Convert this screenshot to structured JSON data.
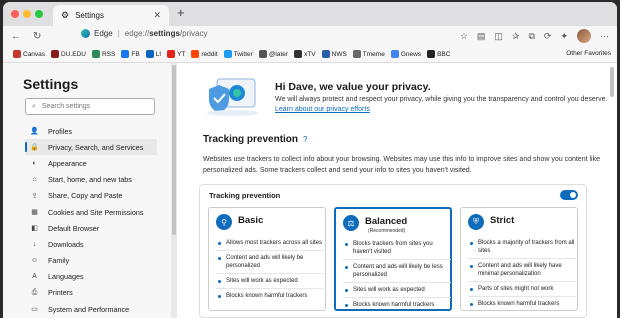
{
  "tab": {
    "title": "Settings",
    "close": "✕",
    "new": "+"
  },
  "address": {
    "site_label": "Edge",
    "url_prefix": "edge://",
    "url_path": "settings",
    "url_suffix": "/privacy"
  },
  "bookmarks": [
    {
      "label": "Canvas",
      "color": "#c0392b"
    },
    {
      "label": "DU.EDU",
      "color": "#8b1a1a"
    },
    {
      "label": "RSS",
      "color": "#2e8b57"
    },
    {
      "label": "FB",
      "color": "#1877f2"
    },
    {
      "label": "LI",
      "color": "#0a66c2"
    },
    {
      "label": "YT",
      "color": "#e62117"
    },
    {
      "label": "reddit",
      "color": "#ff4500"
    },
    {
      "label": "Twitter",
      "color": "#1d9bf0"
    },
    {
      "label": "@later",
      "color": "#555555"
    },
    {
      "label": "xTV",
      "color": "#333333"
    },
    {
      "label": "NWS",
      "color": "#2b5fa8"
    },
    {
      "label": "Tmeme",
      "color": "#666666"
    },
    {
      "label": "Gnews",
      "color": "#4285f4"
    },
    {
      "label": "BBC",
      "color": "#222222"
    }
  ],
  "other_favorites": "Other Favorites",
  "sidebar": {
    "title": "Settings",
    "search_placeholder": "Search settings",
    "items": [
      {
        "label": "Profiles",
        "icon": "👤"
      },
      {
        "label": "Privacy, Search, and Services",
        "icon": "🔒"
      },
      {
        "label": "Appearance",
        "icon": "◐"
      },
      {
        "label": "Start, home, and new tabs",
        "icon": "⌂"
      },
      {
        "label": "Share, Copy and Paste",
        "icon": "⇪"
      },
      {
        "label": "Cookies and Site Permissions",
        "icon": "▦"
      },
      {
        "label": "Default Browser",
        "icon": "◧"
      },
      {
        "label": "Downloads",
        "icon": "↓"
      },
      {
        "label": "Family",
        "icon": "☺"
      },
      {
        "label": "Languages",
        "icon": "A"
      },
      {
        "label": "Printers",
        "icon": "⎙"
      },
      {
        "label": "System and Performance",
        "icon": "▭"
      }
    ],
    "selected_index": 1
  },
  "hero": {
    "title": "Hi Dave, we value your privacy.",
    "text": "We will always protect and respect your privacy, while giving you the transparency and control you deserve.",
    "link": "Learn about our privacy efforts"
  },
  "tracking": {
    "heading": "Tracking prevention",
    "help_icon": "?",
    "description": "Websites use trackers to collect info about your browsing. Websites may use this info to improve sites and show you content like personalized ads. Some trackers collect and send your info to sites you haven't visited.",
    "card_label": "Tracking prevention",
    "enabled": true,
    "options": [
      {
        "name": "Basic",
        "icon": "⚲",
        "recommended": "",
        "bullets": [
          "Allows most trackers across all sites",
          "Content and ads will likely be personalized",
          "Sites will work as expected",
          "Blocks known harmful trackers"
        ]
      },
      {
        "name": "Balanced",
        "icon": "⚖",
        "recommended": "(Recommended)",
        "bullets": [
          "Blocks trackers from sites you haven't visited",
          "Content and ads will likely be less personalized",
          "Sites will work as expected",
          "Blocks known harmful trackers"
        ]
      },
      {
        "name": "Strict",
        "icon": "⛨",
        "recommended": "",
        "bullets": [
          "Blocks a majority of trackers from all sites",
          "Content and ads will likely have minimal personalization",
          "Parts of sites might not work",
          "Blocks known harmful trackers"
        ]
      }
    ],
    "selected_option": 1
  }
}
